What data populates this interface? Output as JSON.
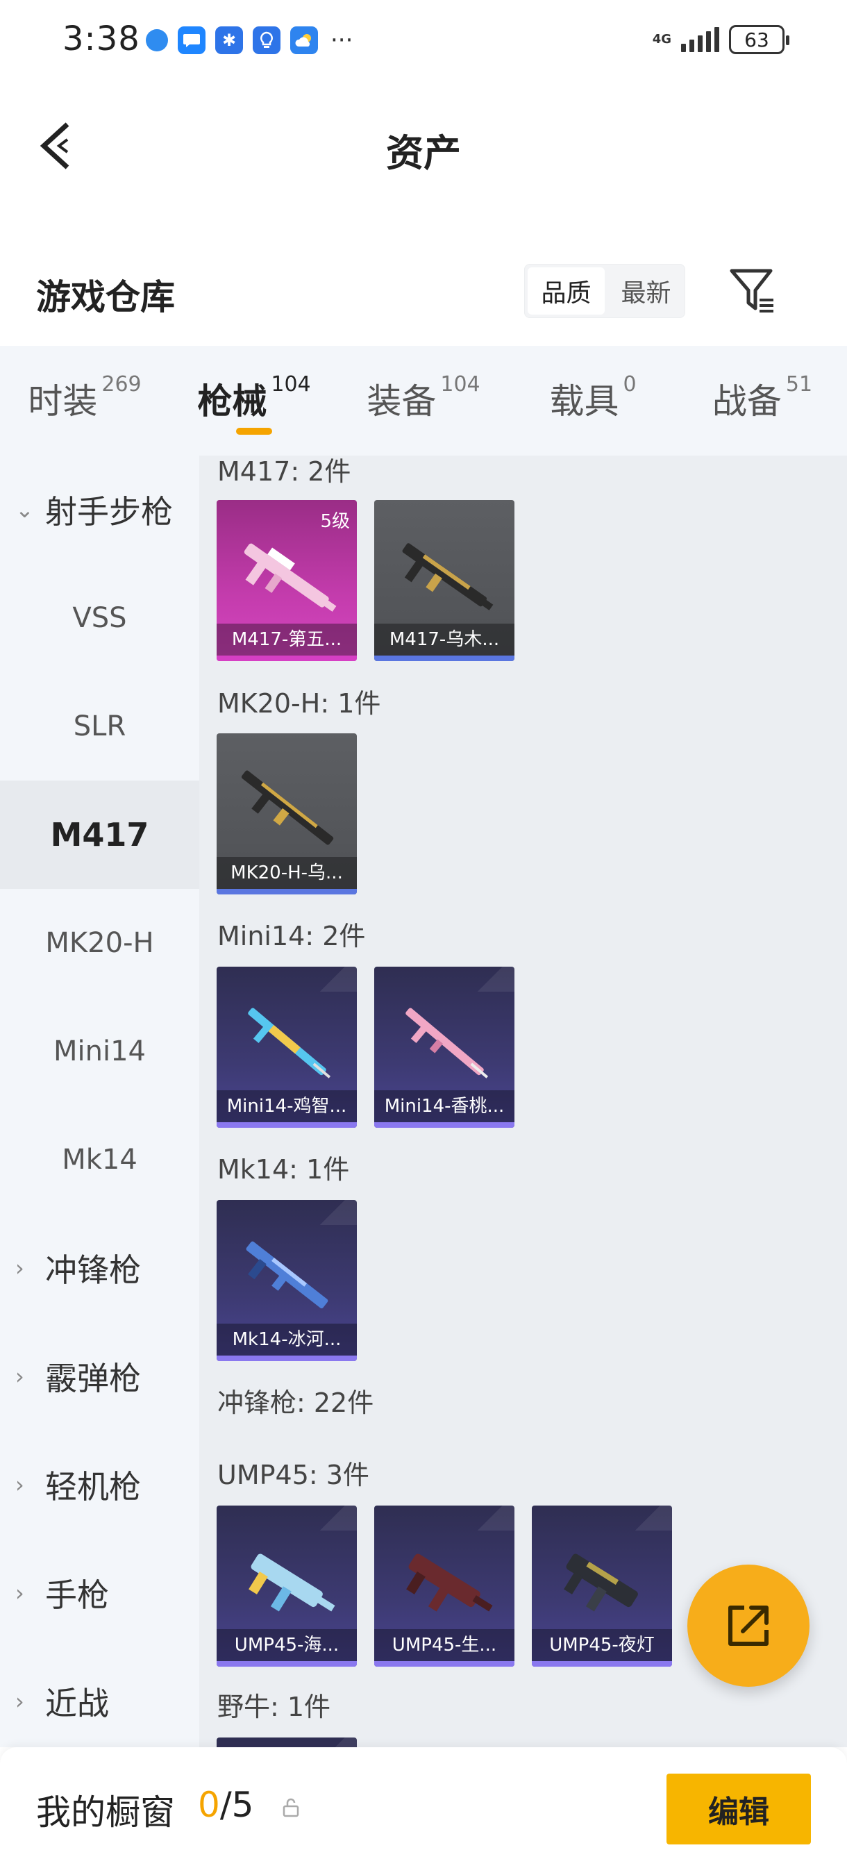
{
  "status_bar": {
    "time": "3:38",
    "network": "4G",
    "battery": "63"
  },
  "header": {
    "title": "资产"
  },
  "warehouse": {
    "title": "游戏仓库",
    "sort_quality": "品质",
    "sort_newest": "最新"
  },
  "tabs": [
    {
      "label": "时装",
      "count": "269"
    },
    {
      "label": "枪械",
      "count": "104"
    },
    {
      "label": "装备",
      "count": "104"
    },
    {
      "label": "载具",
      "count": "0"
    },
    {
      "label": "战备",
      "count": "51"
    }
  ],
  "sidebar": {
    "items": [
      {
        "label": "射手步枪",
        "chev": "⌄"
      },
      {
        "label": "VSS"
      },
      {
        "label": "SLR"
      },
      {
        "label": "M417"
      },
      {
        "label": "MK20-H"
      },
      {
        "label": "Mini14"
      },
      {
        "label": "Mk14"
      },
      {
        "label": "冲锋枪",
        "chev": "›"
      },
      {
        "label": "霰弹枪",
        "chev": "›"
      },
      {
        "label": "轻机枪",
        "chev": "›"
      },
      {
        "label": "手枪",
        "chev": "›"
      },
      {
        "label": "近战",
        "chev": "›"
      }
    ]
  },
  "content": {
    "sections": [
      {
        "title": "M417: 2件"
      },
      {
        "title": "MK20-H: 1件"
      },
      {
        "title": "Mini14: 2件"
      },
      {
        "title": "Mk14: 1件"
      },
      {
        "title": "冲锋枪: 22件"
      },
      {
        "title": "UMP45: 3件"
      },
      {
        "title": "野牛: 1件"
      }
    ],
    "cards": [
      {
        "name": "M417-第五...",
        "level": "5级",
        "rarity": "legend"
      },
      {
        "name": "M417-乌木...",
        "rarity": "grey"
      },
      {
        "name": "MK20-H-乌...",
        "rarity": "grey"
      },
      {
        "name": "Mini14-鸡智...",
        "rarity": "purple"
      },
      {
        "name": "Mini14-香桃...",
        "rarity": "purple"
      },
      {
        "name": "Mk14-冰河...",
        "rarity": "purple"
      },
      {
        "name": "UMP45-海...",
        "rarity": "purple"
      },
      {
        "name": "UMP45-生...",
        "rarity": "purple"
      },
      {
        "name": "UMP45-夜灯",
        "rarity": "purple"
      }
    ]
  },
  "bottom_bar": {
    "label": "我的橱窗",
    "current": "0",
    "separator": "/",
    "max": "5",
    "edit": "编辑"
  },
  "colors": {
    "accent": "#f5a400",
    "fab": "#f7ad1a",
    "edit_button": "#f7b500",
    "sidebar_bg": "#f3f6fa",
    "content_bg": "#ebeef2"
  },
  "icons": [
    "back-arrow-icon",
    "filter-icon",
    "share-icon",
    "lock-icon"
  ]
}
